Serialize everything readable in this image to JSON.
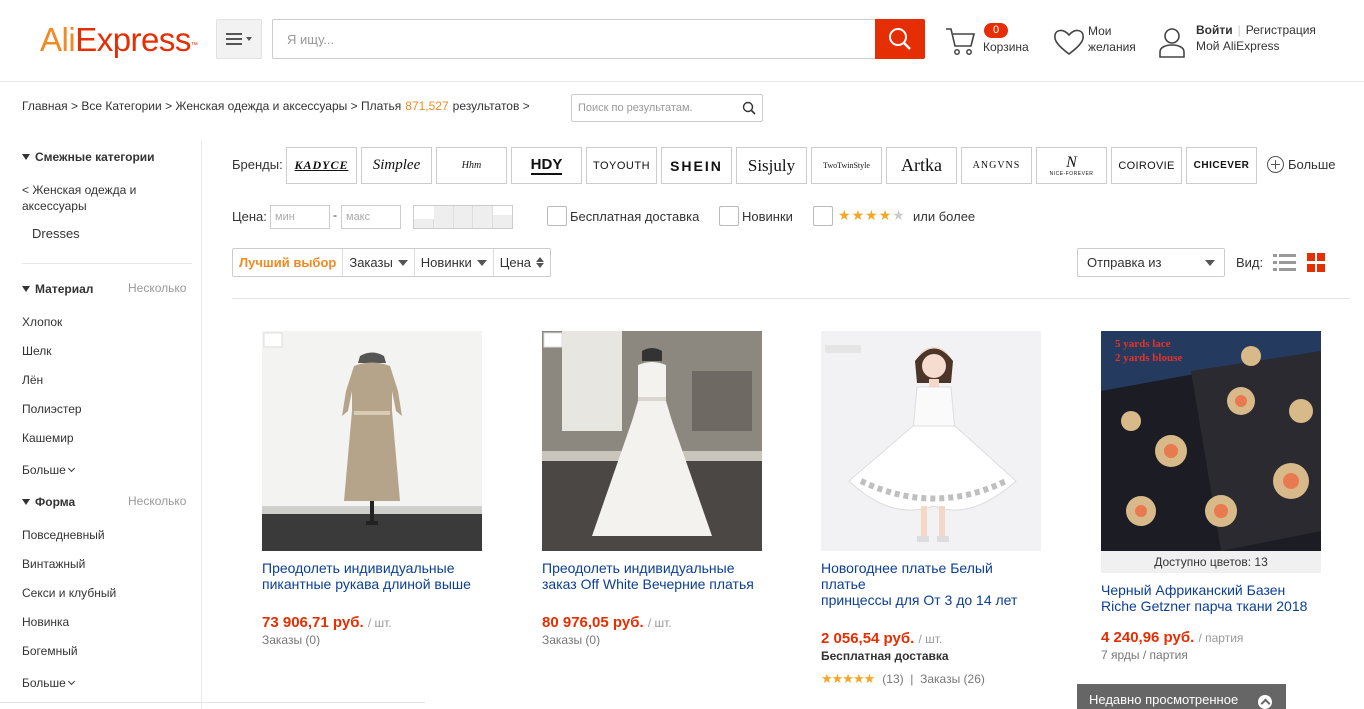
{
  "header": {
    "logo_part1": "Ali",
    "logo_part2": "Express",
    "logo_tm": "™",
    "search_placeholder": "Я ищу...",
    "cart_count": "0",
    "cart_label": "Корзина",
    "wishlist_line1": "Мои",
    "wishlist_line2": "желания",
    "login": "Войти",
    "register": "Регистрация",
    "my_account": "Мой AliExpress"
  },
  "breadcrumb": {
    "home": "Главная",
    "all_categories": "Все Категории",
    "category": "Женская одежда и аксессуары",
    "current": "Платья",
    "count": "871,527",
    "results_label": "результатов",
    "sep": ">",
    "search_placeholder": "Поиск по результатам."
  },
  "sidebar": {
    "related_title": "Смежные категории",
    "related_parent_line1": "< Женская одежда и",
    "related_parent_line2": "аксессуары",
    "related_current": "Dresses",
    "material_title": "Материал",
    "multiple_label": "Несколько",
    "material_items": [
      "Хлопок",
      "Шелк",
      "Лён",
      "Полиэстер",
      "Кашемир"
    ],
    "more_label": "Больше",
    "shape_title": "Форма",
    "shape_items": [
      "Повседневный",
      "Винтажный",
      "Секси и клубный",
      "Новинка",
      "Богемный"
    ]
  },
  "filters": {
    "brands_label": "Бренды:",
    "brands": [
      "KADYCE",
      "Simplee",
      "Hhm",
      "HDY",
      "TOYOUTH",
      "SHEIN",
      "Sisjuly",
      "TwoTwinStyle",
      "Artka",
      "ANGVNS",
      "NICE-FOREVER",
      "COIROVIE",
      "CHICEVER"
    ],
    "brands_more": "Больше",
    "price_label": "Цена:",
    "price_min": "мин",
    "price_max": "макс",
    "free_shipping": "Бесплатная доставка",
    "new_arrivals": "Новинки",
    "rating_or_more": "или более",
    "rating_stars": 4
  },
  "sort": {
    "best_match": "Лучший выбор",
    "orders": "Заказы",
    "newest": "Новинки",
    "price": "Цена",
    "ship_from": "Отправка из",
    "view_label": "Вид:"
  },
  "products": [
    {
      "title_line1": "Преодолеть индивидуальные",
      "title_line2": "пикантные рукава длиной выше",
      "price": "73 906,71 руб.",
      "unit": "/ шт.",
      "orders": "Заказы (0)"
    },
    {
      "title_line1": "Преодолеть индивидуальные",
      "title_line2": "заказ Off White Вечерние платья",
      "price": "80 976,05 руб.",
      "unit": "/ шт.",
      "orders": "Заказы (0)"
    },
    {
      "title_line1": "Новогоднее платье Белый платье",
      "title_line2": "принцессы для От 3 до 14 лет",
      "price": "2 056,54 руб.",
      "unit": "/ шт.",
      "shipping": "Бесплатная доставка",
      "rating_count": "(13)",
      "rating_sep": "|",
      "orders": "Заказы (26)"
    },
    {
      "colors": "Доступно цветов: 13",
      "title_line1": "Черный Африканский Базен",
      "title_line2": "Riche Getzner парча ткани 2018",
      "price": "4 240,96 руб.",
      "unit": "/ партия",
      "lot_info": "7 ярды / партия",
      "image_text1": "5 yards lace",
      "image_text2": "2 yards blouse"
    }
  ],
  "recently_viewed": "Недавно просмотренное",
  "colors": {
    "brand_orange": "#f08a24",
    "brand_red": "#e62e04",
    "link_blue": "#0b3f94",
    "star": "#f6a623"
  }
}
